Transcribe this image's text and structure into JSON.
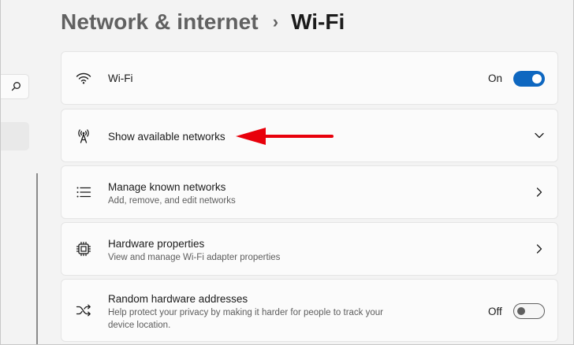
{
  "breadcrumb": {
    "parent": "Network & internet",
    "separator": "›",
    "current": "Wi-Fi"
  },
  "cards": {
    "wifi": {
      "icon": "wifi-icon",
      "title": "Wi-Fi",
      "state_label": "On",
      "toggle_on": true
    },
    "available_networks": {
      "icon": "antenna-icon",
      "title": "Show available networks",
      "expander": "chevron-down-icon"
    },
    "known_networks": {
      "icon": "list-icon",
      "title": "Manage known networks",
      "subtitle": "Add, remove, and edit networks",
      "expander": "chevron-right-icon"
    },
    "hardware": {
      "icon": "chip-icon",
      "title": "Hardware properties",
      "subtitle": "View and manage Wi-Fi adapter properties",
      "expander": "chevron-right-icon"
    },
    "random_mac": {
      "icon": "shuffle-icon",
      "title": "Random hardware addresses",
      "subtitle_line1": "Help protect your privacy by making it harder for people to track your",
      "subtitle_line2": "device location.",
      "state_label": "Off",
      "toggle_on": false
    }
  },
  "colors": {
    "accent": "#0e67c0",
    "annotation_arrow": "#e8000b",
    "background": "#f3f3f3",
    "card": "#fbfbfb"
  },
  "left_nav": {
    "search_icon": "search-icon"
  }
}
